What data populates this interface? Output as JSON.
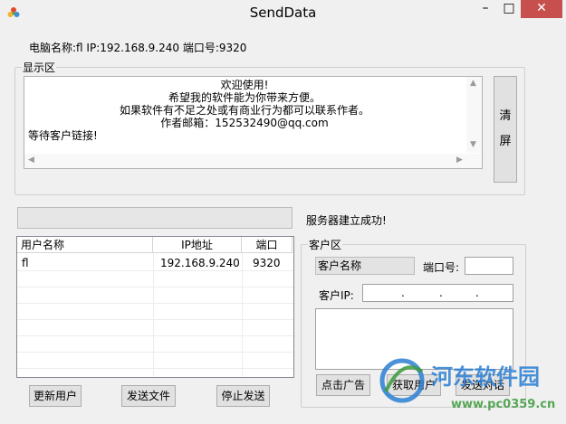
{
  "window": {
    "title": "SendData",
    "minimize_glyph": "–",
    "maximize_glyph": "□",
    "close_glyph": "✕"
  },
  "info": {
    "text": "电脑名称:fl  IP:192.168.9.240  端口号:9320"
  },
  "display": {
    "legend": "显示区",
    "lines": [
      "欢迎使用!",
      "希望我的软件能为你带来方便。",
      "如果软件有不足之处或有商业行为都可以联系作者。",
      "作者邮箱：152532490@qq.com",
      "等待客户链接!"
    ],
    "clear_button": [
      "清",
      "屏"
    ]
  },
  "status": {
    "text": "服务器建立成功!"
  },
  "userlist": {
    "columns": [
      "用户名称",
      "IP地址",
      "端口"
    ],
    "rows": [
      {
        "name": "fl",
        "ip": "192.168.9.240",
        "port": "9320"
      }
    ]
  },
  "buttons": {
    "refresh": "更新用户",
    "send_file": "发送文件",
    "stop": "停止发送"
  },
  "client": {
    "legend": "客户区",
    "name_label": "客户名称",
    "port_label": "端口号:",
    "ip_label": "客户IP:",
    "ad_button": "点击广告",
    "get_button": "获取用户",
    "chat_button": "发送对话"
  },
  "watermark": {
    "line1": "河东软件园",
    "line2": "www.pc0359.cn"
  },
  "colors": {
    "close_button": "#c7504f",
    "watermark_blue": "#2a7fd4",
    "watermark_green": "#3b9a3b"
  }
}
